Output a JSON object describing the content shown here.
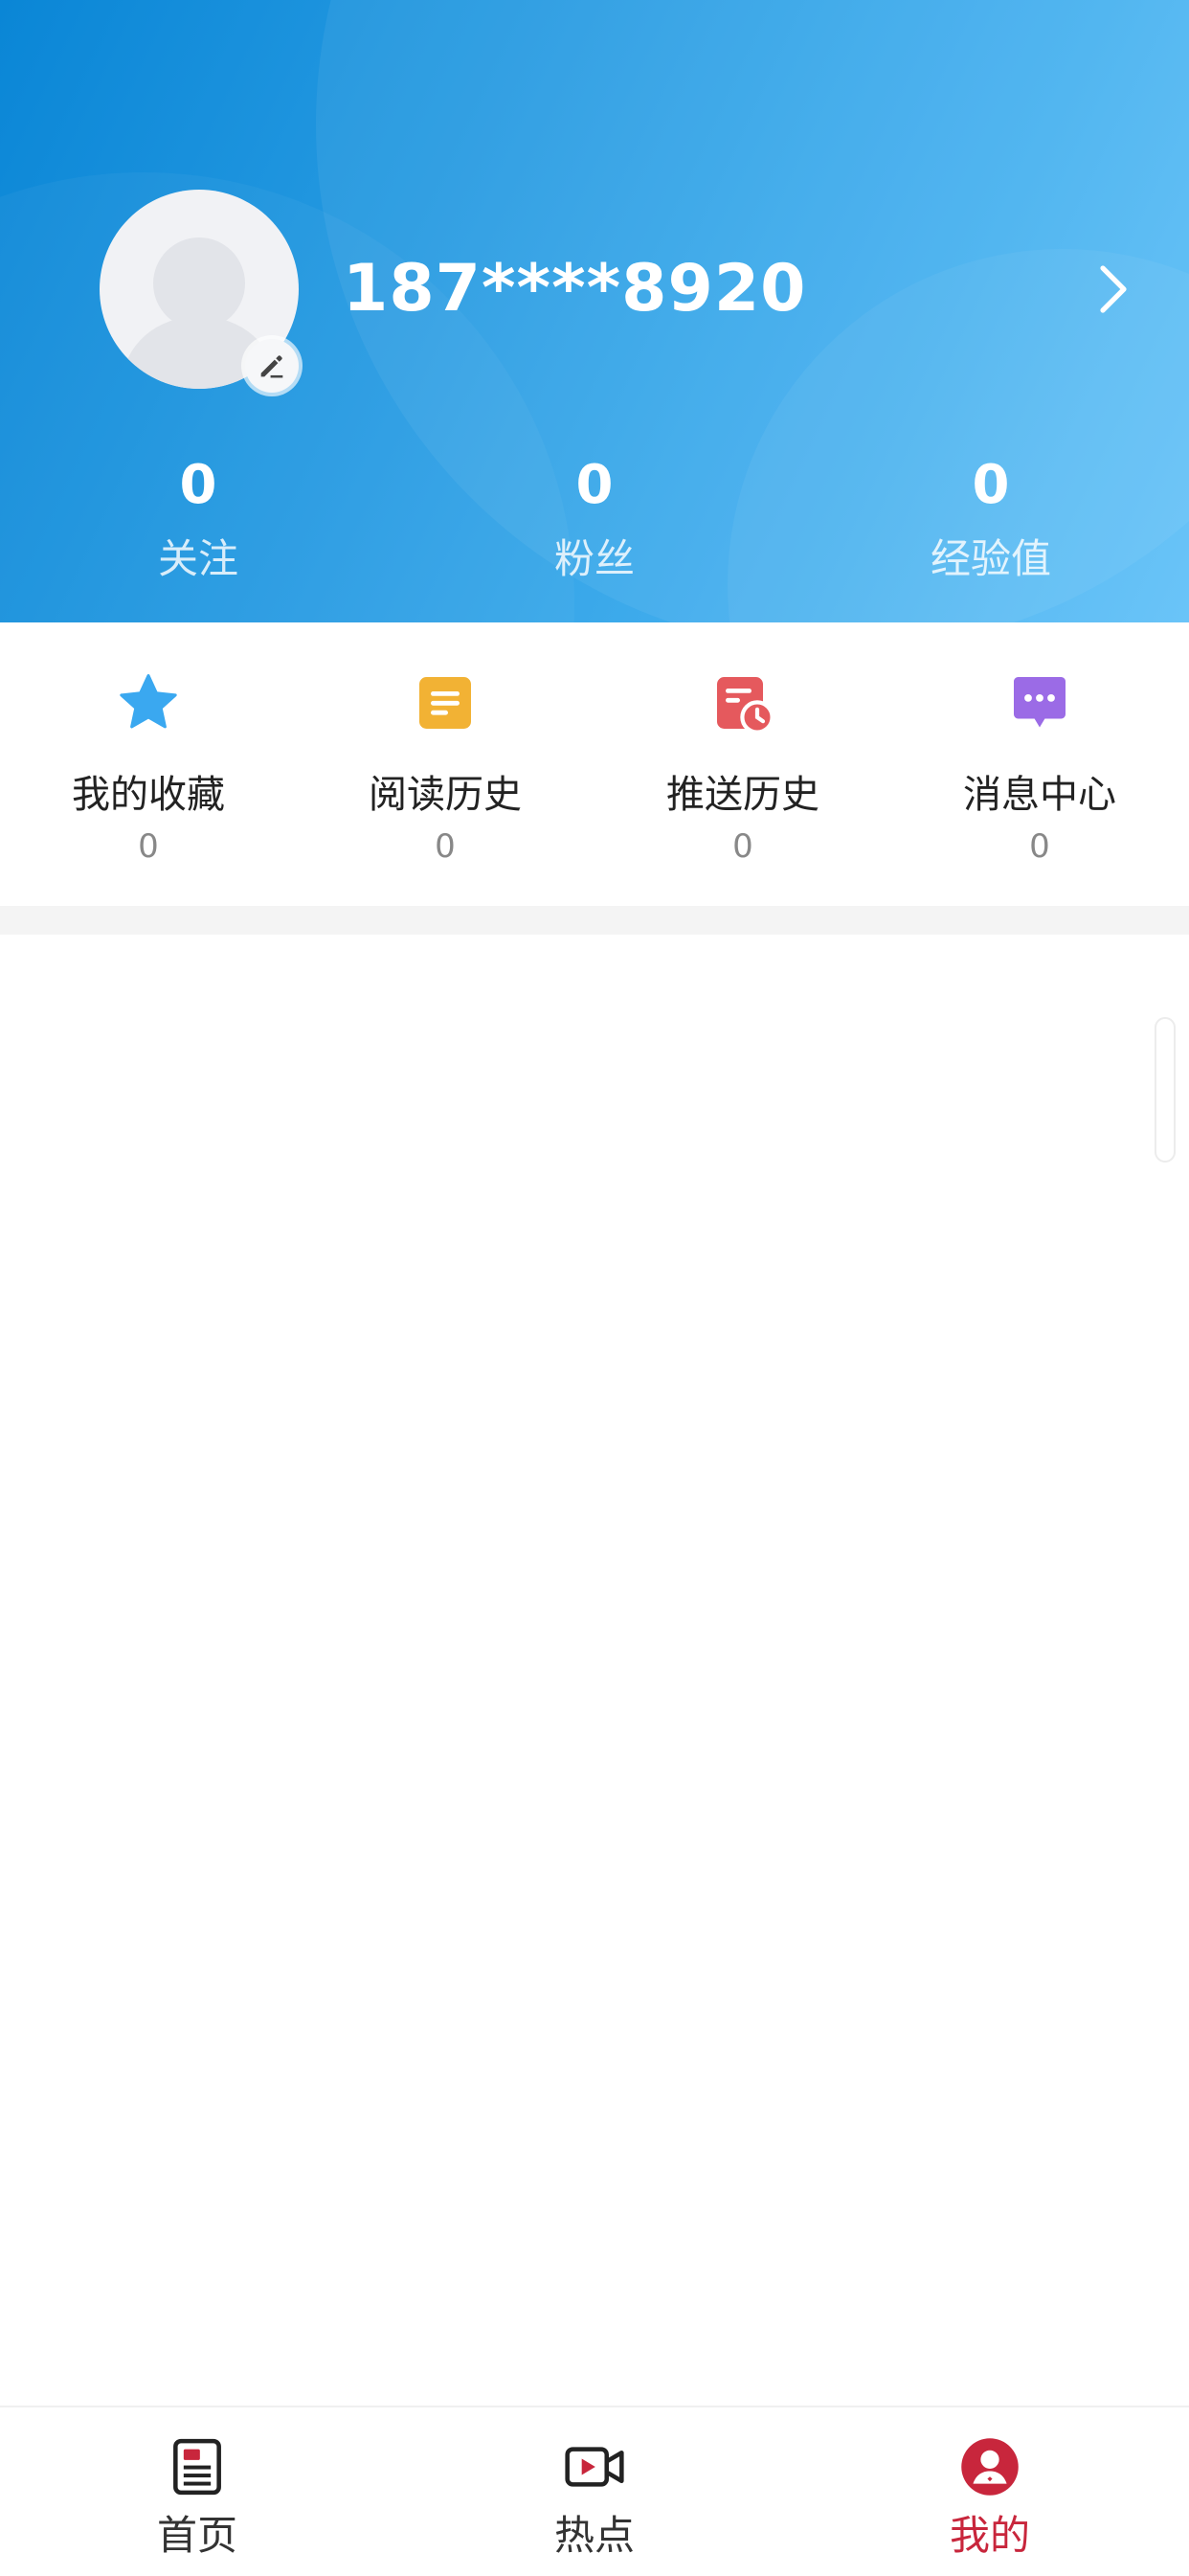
{
  "profile": {
    "username": "187****8920",
    "avatar_icon": "default-avatar-icon",
    "edit_icon": "pencil-icon",
    "arrow_icon": "chevron-right-icon"
  },
  "stats": [
    {
      "value": "0",
      "label": "关注"
    },
    {
      "value": "0",
      "label": "粉丝"
    },
    {
      "value": "0",
      "label": "经验值"
    }
  ],
  "features": [
    {
      "label": "我的收藏",
      "count": "0",
      "icon": "star-icon",
      "color": "#3aa8f0"
    },
    {
      "label": "阅读历史",
      "count": "0",
      "icon": "document-icon",
      "color": "#f2b234"
    },
    {
      "label": "推送历史",
      "count": "0",
      "icon": "calendar-clock-icon",
      "color": "#e5595d"
    },
    {
      "label": "消息中心",
      "count": "0",
      "icon": "chat-bubble-icon",
      "color": "#9b6be6"
    }
  ],
  "tabs": [
    {
      "label": "首页",
      "icon": "news-document-icon",
      "active": false
    },
    {
      "label": "热点",
      "icon": "video-camera-icon",
      "active": false
    },
    {
      "label": "我的",
      "icon": "user-profile-icon",
      "active": true
    }
  ],
  "colors": {
    "header_start": "#0a86d6",
    "header_end": "#62c1f8",
    "accent_red": "#c8263c"
  }
}
